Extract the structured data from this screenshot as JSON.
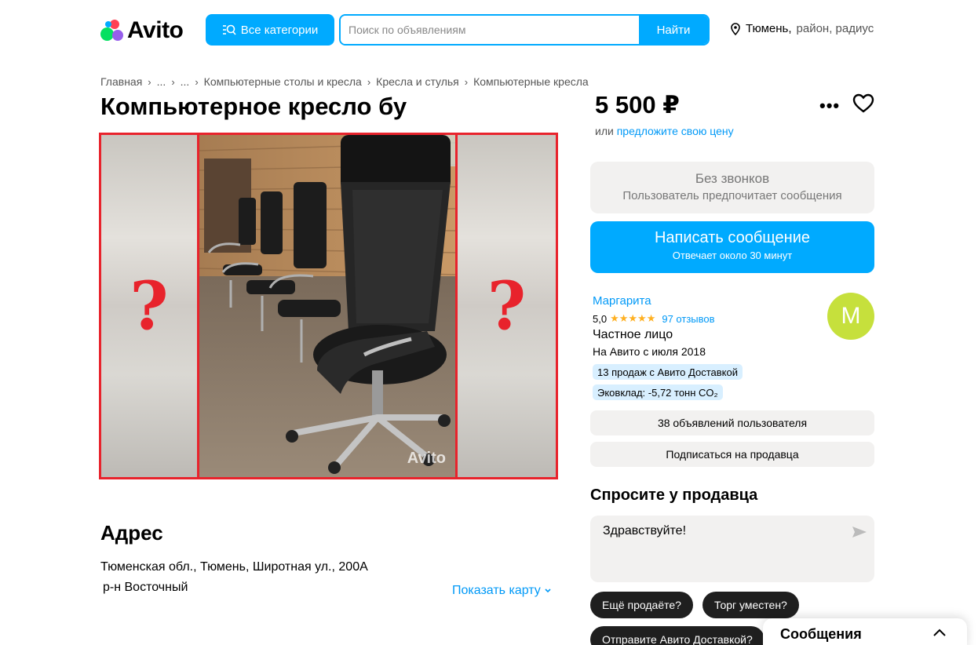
{
  "header": {
    "logo_text": "Avito",
    "categories_button": "Все категории",
    "search_placeholder": "Поиск по объявлениям",
    "search_button": "Найти",
    "location_city": "Тюмень,",
    "location_rest": "район, радиус"
  },
  "breadcrumb": [
    "Главная",
    "...",
    "...",
    "Компьютерные столы и кресла",
    "Кресла и стулья",
    "Компьютерные кресла"
  ],
  "listing": {
    "title": "Компьютерное кресло бу",
    "watermark": "Avito",
    "unknown_mark": "?"
  },
  "address": {
    "heading": "Адрес",
    "line1": "Тюменская обл., Тюмень, Широтная ул., 200А",
    "line2": "р-н Восточный",
    "map_link": "Показать карту"
  },
  "price": {
    "value": "5 500 ₽",
    "offer_prefix": "или",
    "offer_link": "предложите свою цену"
  },
  "contact": {
    "no_calls_title": "Без звонков",
    "no_calls_sub": "Пользователь предпочитает сообщения",
    "message_button": "Написать сообщение",
    "message_sub": "Отвечает около 30 минут"
  },
  "seller": {
    "name": "Маргарита",
    "rating": "5,0",
    "stars": "★★★★★",
    "reviews": "97 отзывов",
    "type": "Частное лицо",
    "since": "На Авито с июля 2018",
    "badge_delivery": "13 продаж с Авито Доставкой",
    "badge_eco": "Эковклад: -5,72 тонн CO₂",
    "avatar_letter": "М",
    "listings_button": "38 объявлений пользователя",
    "subscribe_button": "Подписаться на продавца"
  },
  "ask": {
    "heading": "Спросите у продавца",
    "message_text": "Здравствуйте!",
    "chips": [
      "Ещё продаёте?",
      "Торг уместен?",
      "Отправите Авито Доставкой?"
    ]
  },
  "messages_panel": {
    "title": "Сообщения"
  },
  "colors": {
    "accent": "#00aaff",
    "link": "#0099f7",
    "highlight_border": "#e8232c",
    "star": "#ffb021",
    "avatar_bg": "#c6e03c"
  }
}
